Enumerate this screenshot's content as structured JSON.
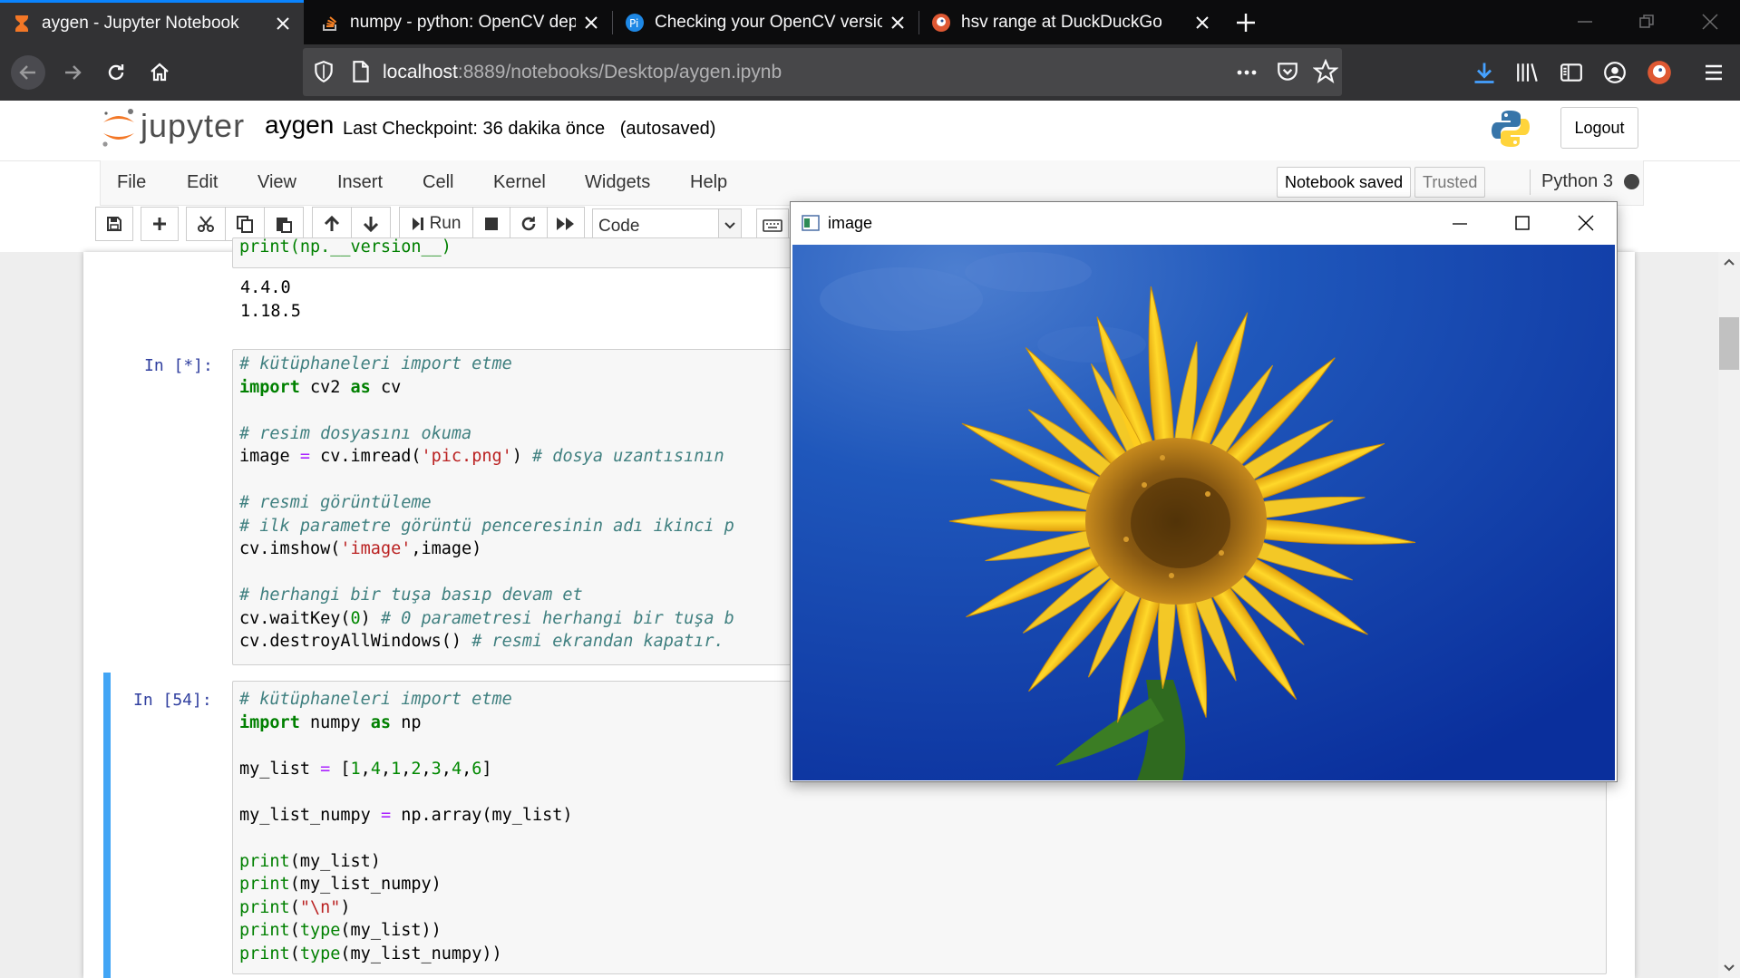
{
  "browser": {
    "tabs": [
      {
        "title": "aygen - Jupyter Notebook",
        "active": true,
        "favicon": "hourglass-icon"
      },
      {
        "title": "numpy - python: OpenCV dept",
        "active": false,
        "favicon": "stackoverflow-icon"
      },
      {
        "title": "Checking your OpenCV version",
        "active": false,
        "favicon": "pyimagesearch-icon"
      },
      {
        "title": "hsv range at DuckDuckGo",
        "active": false,
        "favicon": "duckduckgo-icon"
      }
    ],
    "url_host": "localhost",
    "url_path": ":8889/notebooks/Desktop/aygen.ipynb"
  },
  "jupyter": {
    "logo_text": "jupyter",
    "notebook_name": "aygen",
    "checkpoint": "Last Checkpoint: 36 dakika önce",
    "autosaved": "(autosaved)",
    "logout_label": "Logout",
    "menu": [
      "File",
      "Edit",
      "View",
      "Insert",
      "Cell",
      "Kernel",
      "Widgets",
      "Help"
    ],
    "notebook_status": "Notebook saved",
    "trusted": "Trusted",
    "kernel": "Python 3",
    "toolbar": {
      "run_label": "Run",
      "cell_type": "Code"
    }
  },
  "cells": {
    "cell0_partial_code": "print(np.__version__)",
    "cell0_output": [
      "4.4.0",
      "1.18.5"
    ],
    "cell1_prompt": "In [*]:",
    "cell2_prompt": "In [54]:"
  },
  "image_window": {
    "title": "image"
  },
  "colors": {
    "tab_accent": "#0a84ff",
    "prompt": "#303f9f",
    "selected_cell_bar": "#42a5f5",
    "sky_blue": "#0a3ea8",
    "petal_yellow": "#f7c51a"
  }
}
